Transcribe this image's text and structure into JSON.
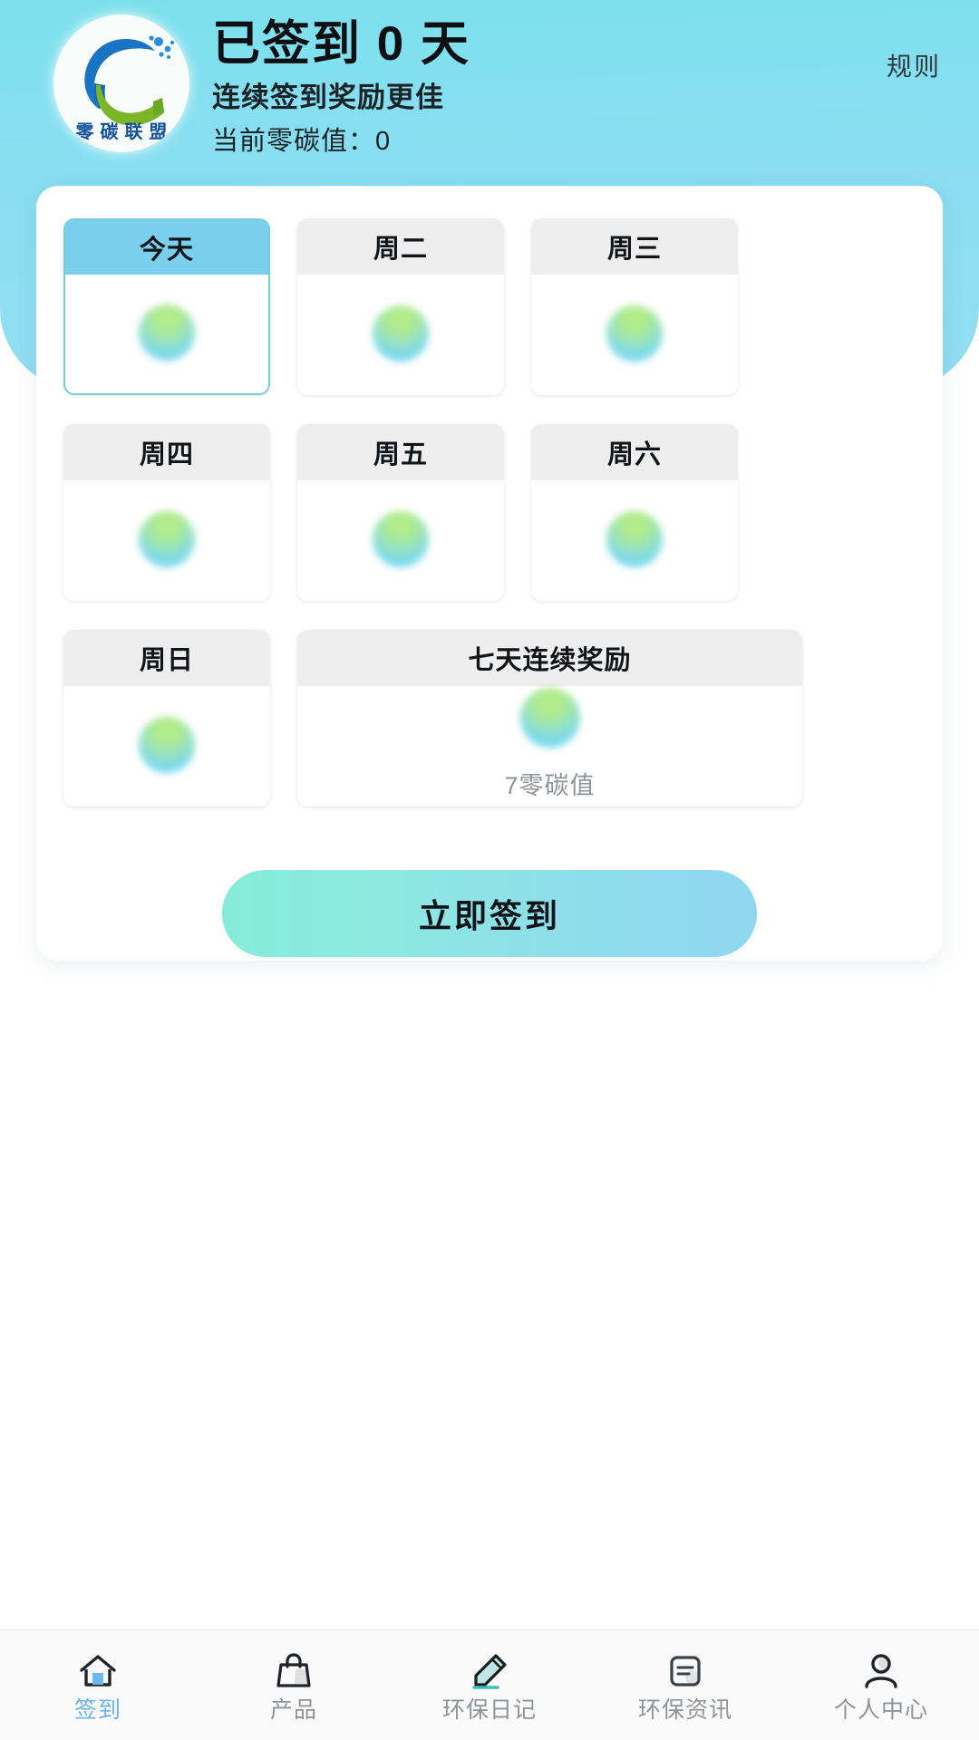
{
  "header": {
    "logo_alt": "零碳联盟",
    "logo_text": "零 碳 联 盟",
    "title": "已签到 0 天",
    "subtitle": "连续签到奖励更佳",
    "carbon_value_label": "当前零碳值：0",
    "rules_label": "规则",
    "banner_color": "#8adef2"
  },
  "checkin": {
    "days": [
      {
        "label": "今天",
        "today": true,
        "wide": false,
        "reward": ""
      },
      {
        "label": "周二",
        "today": false,
        "wide": false,
        "reward": ""
      },
      {
        "label": "周三",
        "today": false,
        "wide": false,
        "reward": ""
      },
      {
        "label": "周四",
        "today": false,
        "wide": false,
        "reward": ""
      },
      {
        "label": "周五",
        "today": false,
        "wide": false,
        "reward": ""
      },
      {
        "label": "周六",
        "today": false,
        "wide": false,
        "reward": ""
      },
      {
        "label": "周日",
        "today": false,
        "wide": false,
        "reward": ""
      },
      {
        "label": "七天连续奖励",
        "today": false,
        "wide": true,
        "reward": "7零碳值"
      }
    ],
    "submit_label": "立即签到",
    "today_accent": "#79cfed",
    "button_gradient_from": "#86ecd8",
    "button_gradient_to": "#8fd7f1"
  },
  "tabbar": {
    "items": [
      {
        "label": "签到",
        "icon": "home-icon",
        "active": true
      },
      {
        "label": "产品",
        "icon": "bag-icon",
        "active": false
      },
      {
        "label": "环保日记",
        "icon": "pencil-icon",
        "active": false
      },
      {
        "label": "环保资讯",
        "icon": "document-icon",
        "active": false
      },
      {
        "label": "个人中心",
        "icon": "person-icon",
        "active": false
      }
    ],
    "active_color": "#6ab4e8",
    "inactive_color": "#8e9396"
  }
}
